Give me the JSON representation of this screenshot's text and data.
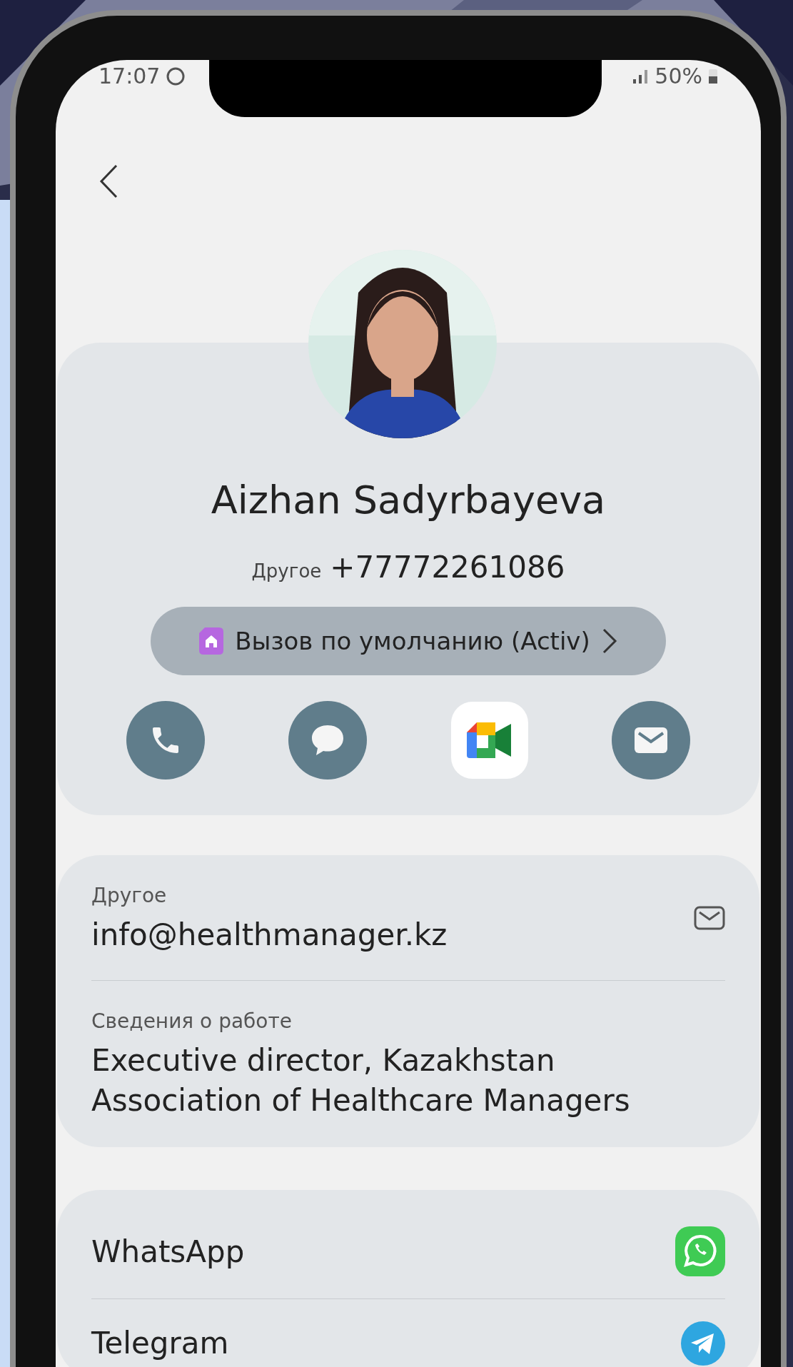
{
  "status_bar": {
    "time": "17:07",
    "battery": "50%"
  },
  "contact": {
    "name": "Aizhan Sadyrbayeva",
    "phone_label": "Другое",
    "phone": "+77772261086",
    "default_call": "Вызов по умолчанию (Activ)"
  },
  "actions": [
    {
      "kind": "call"
    },
    {
      "kind": "message"
    },
    {
      "kind": "video"
    },
    {
      "kind": "email"
    }
  ],
  "details": [
    {
      "label": "Другое",
      "value": "info@healthmanager.kz",
      "kind": "email"
    },
    {
      "label": "Сведения о работе",
      "value": "Executive director, Kazakhstan Association of Healthcare Managers",
      "kind": "text"
    }
  ],
  "apps": [
    {
      "name": "WhatsApp",
      "kind": "whatsapp"
    },
    {
      "name": "Telegram",
      "kind": "telegram"
    }
  ]
}
